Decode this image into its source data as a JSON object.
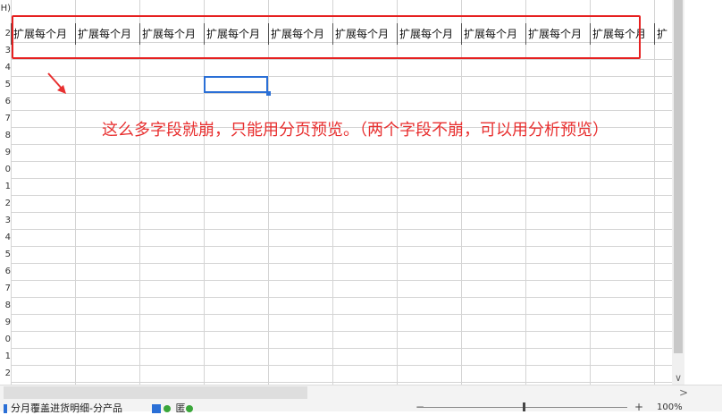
{
  "row_header_top": "H)",
  "row_numbers": [
    "2",
    "3",
    "4",
    "5",
    "6",
    "7",
    "8",
    "9",
    "0",
    "1",
    "2",
    "3",
    "4",
    "5",
    "6",
    "7",
    "8",
    "9",
    "0",
    "1",
    "2"
  ],
  "header_cells": [
    "扩展每个月",
    "扩展每个月",
    "扩展每个月",
    "扩展每个月",
    "扩展每个月",
    "扩展每个月",
    "扩展每个月",
    "扩展每个月",
    "扩展每个月",
    "扩展每个月",
    "扩"
  ],
  "annotation": "这么多字段就崩，只能用分页预览。（两个字段不崩，可以用分析预览）",
  "colors": {
    "annotation": "#e83030",
    "selection": "#2a6fd6",
    "redbox": "#e62020"
  },
  "sheet_tab": "分月覆盖进货明细-分产品",
  "tab2_label": "匿",
  "zoom_minus": "−",
  "zoom_plus": "+",
  "zoom_pct": "100%",
  "vscroll_down": "∨",
  "hscroll_right": ">"
}
